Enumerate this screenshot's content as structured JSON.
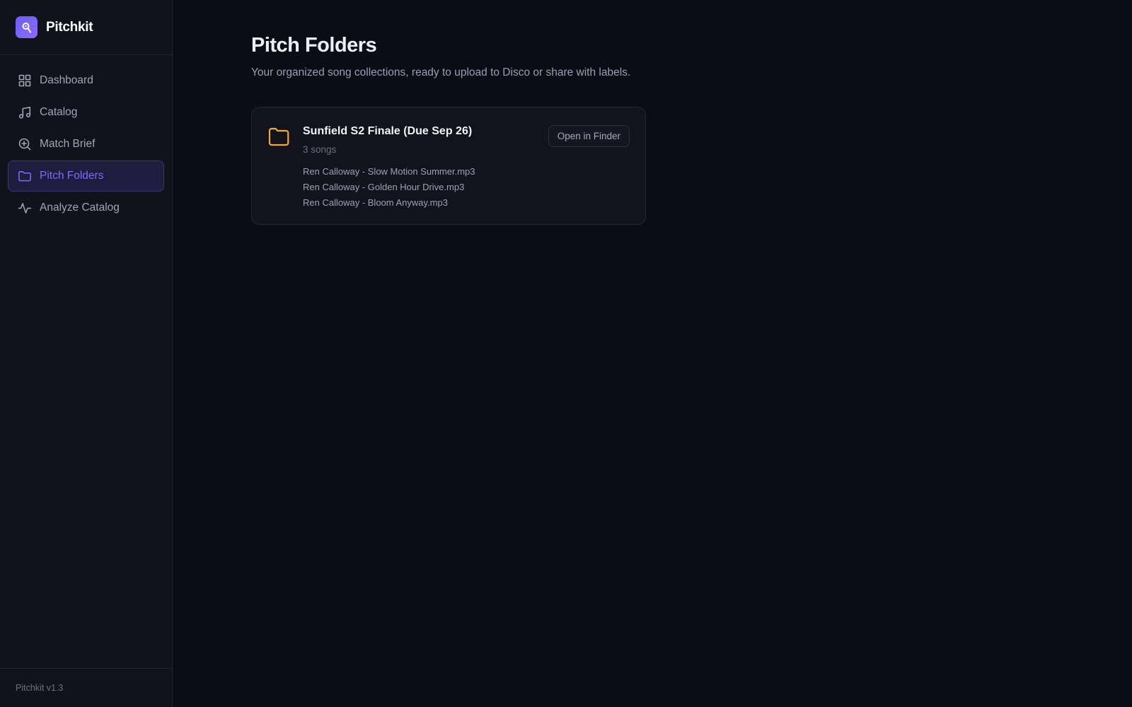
{
  "app": {
    "name": "Pitchkit",
    "version": "Pitchkit v1.3",
    "accent": "#7b6cf5",
    "folder_color": "#f0a93a"
  },
  "sidebar": {
    "items": [
      {
        "label": "Dashboard",
        "icon": "grid-icon",
        "active": false
      },
      {
        "label": "Catalog",
        "icon": "music-note-icon",
        "active": false
      },
      {
        "label": "Match Brief",
        "icon": "search-plus-icon",
        "active": false
      },
      {
        "label": "Pitch Folders",
        "icon": "folder-icon",
        "active": true
      },
      {
        "label": "Analyze Catalog",
        "icon": "activity-icon",
        "active": false
      }
    ]
  },
  "main": {
    "title": "Pitch Folders",
    "subtitle": "Your organized song collections, ready to upload to Disco or share with labels.",
    "folders": [
      {
        "name": "Sunfield S2 Finale (Due Sep 26)",
        "count": "3 songs",
        "files": [
          "Ren Calloway - Slow Motion Summer.mp3",
          "Ren Calloway - Golden Hour Drive.mp3",
          "Ren Calloway - Bloom Anyway.mp3"
        ],
        "action_label": "Open in Finder"
      }
    ]
  }
}
